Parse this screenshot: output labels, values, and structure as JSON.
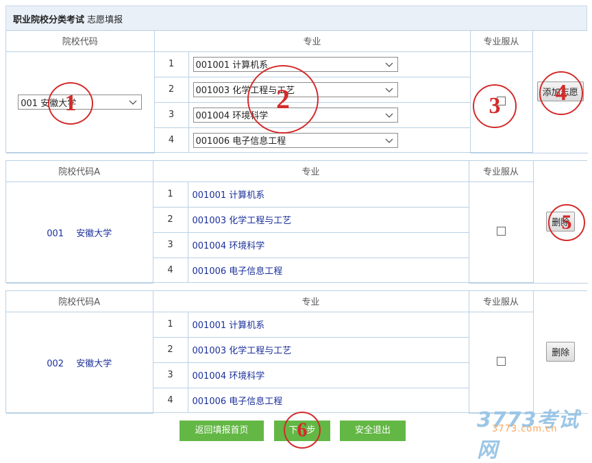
{
  "header": {
    "title_bold": "职业院校分类考试",
    "title_rest": " 志愿填报"
  },
  "form": {
    "col_school": "院校代码",
    "col_major": "专业",
    "col_obey": "专业服从",
    "school_select": "001 安徽大学",
    "rows": [
      {
        "num": "1",
        "major": "001001 计算机系"
      },
      {
        "num": "2",
        "major": "001003 化学工程与工艺"
      },
      {
        "num": "3",
        "major": "001004 环境科学"
      },
      {
        "num": "4",
        "major": "001006 电子信息工程"
      }
    ],
    "add_button": "添加志愿"
  },
  "entries": [
    {
      "col_school": "院校代码A",
      "col_major": "专业",
      "col_obey": "专业服从",
      "school_code": "001",
      "school_name": "安徽大学",
      "rows": [
        {
          "num": "1",
          "major": "001001 计算机系"
        },
        {
          "num": "2",
          "major": "001003 化学工程与工艺"
        },
        {
          "num": "3",
          "major": "001004 环境科学"
        },
        {
          "num": "4",
          "major": "001006 电子信息工程"
        }
      ],
      "delete_button": "删除"
    },
    {
      "col_school": "院校代码A",
      "col_major": "专业",
      "col_obey": "专业服从",
      "school_code": "002",
      "school_name": "安徽大学",
      "rows": [
        {
          "num": "1",
          "major": "001001 计算机系"
        },
        {
          "num": "2",
          "major": "001003 化学工程与工艺"
        },
        {
          "num": "3",
          "major": "001004 环境科学"
        },
        {
          "num": "4",
          "major": "001006 电子信息工程"
        }
      ],
      "delete_button": "删除"
    }
  ],
  "footer": {
    "back": "返回填报首页",
    "next": "下一步",
    "logout": "安全退出"
  },
  "annotations": [
    "1",
    "2",
    "3",
    "4",
    "5",
    "6"
  ],
  "watermark": {
    "brand": "3773考试网",
    "url": "3773.com.cn"
  },
  "colors": {
    "accent_green": "#63b745",
    "link_blue": "#1a2f9a",
    "annotation_red": "#d42a2a",
    "border_blue": "#b9d0e4"
  }
}
